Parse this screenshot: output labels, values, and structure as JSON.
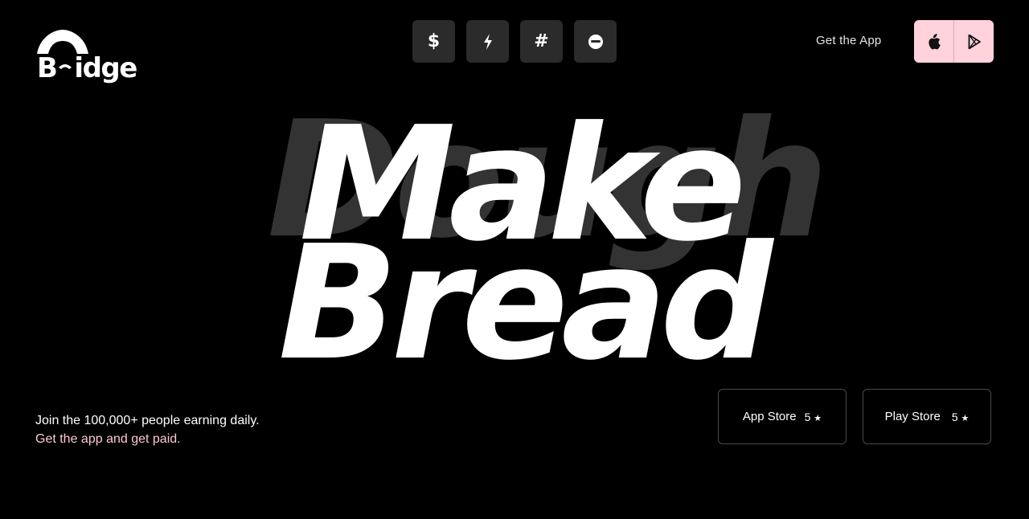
{
  "brand": {
    "name": "Bridge",
    "logo_prefix": "B",
    "logo_suffix": "idge"
  },
  "nav": {
    "icon_buttons": [
      {
        "name": "dollar-icon",
        "glyph": "$"
      },
      {
        "name": "lightning-icon",
        "glyph": "⚡"
      },
      {
        "name": "hash-icon",
        "glyph": "#"
      },
      {
        "name": "smile-icon",
        "glyph": ""
      }
    ],
    "get_app_label": "Get the App",
    "store_icons": [
      "apple-icon",
      "google-play-icon"
    ]
  },
  "hero": {
    "ghost_word": "Dough",
    "line1": "Make",
    "line2": "Bread"
  },
  "tagline": {
    "line1": "Join the 100,000+ people earning daily.",
    "line2": "Get the app and get paid."
  },
  "ratings": [
    {
      "store": "App Store",
      "score": "5",
      "star": "★"
    },
    {
      "store": "Play Store",
      "score": "5",
      "star": "★"
    }
  ],
  "colors": {
    "background": "#000000",
    "accent_pink": "#ffd2dc",
    "tagline_pink": "#ffc8d4",
    "icon_button_bg": "#2b2b2b",
    "ghost_text": "#333333"
  }
}
